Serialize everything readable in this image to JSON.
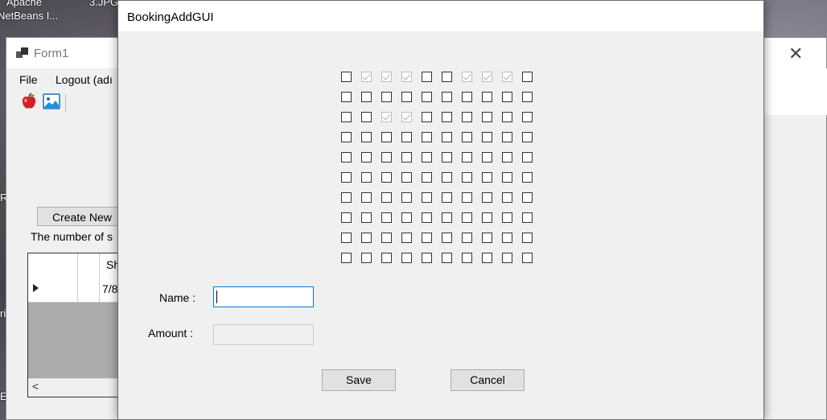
{
  "desktop": {
    "labels": [
      "Apache",
      "3.JPG",
      "NetBeans I..."
    ],
    "edge_letters": [
      "R",
      "ri",
      "E"
    ]
  },
  "form1": {
    "title": "Form1",
    "menu": [
      "File",
      "Logout (adı"
    ],
    "toolbar_icons": [
      "apple-icon",
      "image-icon"
    ],
    "create_button": "Create New",
    "count_label": "The number of s",
    "grid": {
      "header": [
        "",
        "",
        "Sh"
      ],
      "rows": [
        [
          "",
          "",
          "7/8"
        ]
      ]
    }
  },
  "dialog": {
    "title": "BookingAddGUI",
    "seats": {
      "rows": 10,
      "cols": 10,
      "booked": [
        [
          0,
          1
        ],
        [
          0,
          2
        ],
        [
          0,
          3
        ],
        [
          0,
          6
        ],
        [
          0,
          7
        ],
        [
          0,
          8
        ],
        [
          2,
          2
        ],
        [
          2,
          3
        ]
      ]
    },
    "name_label": "Name :",
    "name_value": "",
    "amount_label": "Amount :",
    "amount_value": "",
    "save_label": "Save",
    "cancel_label": "Cancel"
  },
  "colors": {
    "focus_border": "#0078d7",
    "window_bg": "#f0f0f0"
  }
}
